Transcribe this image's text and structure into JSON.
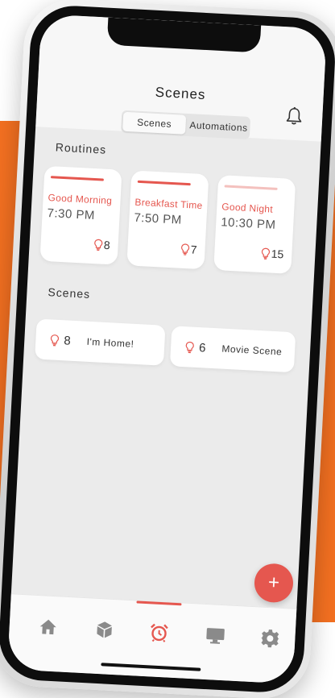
{
  "header": {
    "title": "Scenes",
    "segments": [
      {
        "label": "Scenes",
        "active": true
      },
      {
        "label": "Automations",
        "active": false
      }
    ]
  },
  "routines": {
    "section_label": "Routines",
    "items": [
      {
        "name": "Good Morning",
        "time": "7:30 PM",
        "lights": "8"
      },
      {
        "name": "Breakfast Time",
        "time": "7:50 PM",
        "lights": "7"
      },
      {
        "name": "Good Night",
        "time": "10:30 PM",
        "lights": "15"
      }
    ]
  },
  "scenes": {
    "section_label": "Scenes",
    "items": [
      {
        "lights": "8",
        "name": "I'm Home!"
      },
      {
        "lights": "6",
        "name": "Movie Scene"
      }
    ]
  },
  "fab": {
    "label": "+"
  },
  "tabbar": {
    "items": [
      {
        "icon": "home-icon"
      },
      {
        "icon": "cube-icon"
      },
      {
        "icon": "alarm-clock-icon",
        "active": true
      },
      {
        "icon": "monitor-icon"
      },
      {
        "icon": "gear-icon"
      }
    ]
  },
  "colors": {
    "accent": "#e5574f",
    "background_block": "#f37021",
    "screen_bg": "#ebebeb"
  }
}
